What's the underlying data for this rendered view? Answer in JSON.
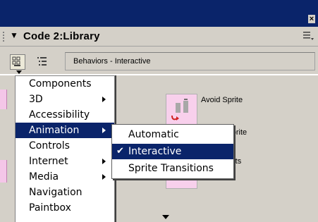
{
  "window": {
    "close_glyph": "×"
  },
  "panel": {
    "title": "Code 2:Library",
    "collapse_icon": "triangle-down-icon",
    "options_icon": "panel-options-icon"
  },
  "toolbar": {
    "add_icon": "library-grid-icon",
    "tree_icon": "tree-view-icon",
    "category": "Behaviors - Interactive"
  },
  "behaviors": [
    {
      "label": "Avoid Sprite"
    },
    {
      "label": "n to Sprite"
    },
    {
      "label": "id Points"
    }
  ],
  "main_menu": {
    "items": [
      {
        "label": "Components",
        "has_submenu": false
      },
      {
        "label": "3D",
        "has_submenu": true
      },
      {
        "label": "Accessibility",
        "has_submenu": false
      },
      {
        "label": "Animation",
        "has_submenu": true,
        "highlighted": true
      },
      {
        "label": "Controls",
        "has_submenu": false
      },
      {
        "label": "Internet",
        "has_submenu": true
      },
      {
        "label": "Media",
        "has_submenu": true
      },
      {
        "label": "Navigation",
        "has_submenu": false
      },
      {
        "label": "Paintbox",
        "has_submenu": false
      }
    ]
  },
  "sub_menu": {
    "items": [
      {
        "label": "Automatic",
        "checked": false
      },
      {
        "label": "Interactive",
        "checked": true,
        "highlighted": true
      },
      {
        "label": "Sprite Transitions",
        "checked": false
      }
    ],
    "check_glyph": "✔"
  },
  "colors": {
    "title_bar": "#0a246a",
    "panel_bg": "#d4d0c8",
    "highlight": "#0a246a",
    "thumbnail_pink": "#f8d0ec"
  }
}
